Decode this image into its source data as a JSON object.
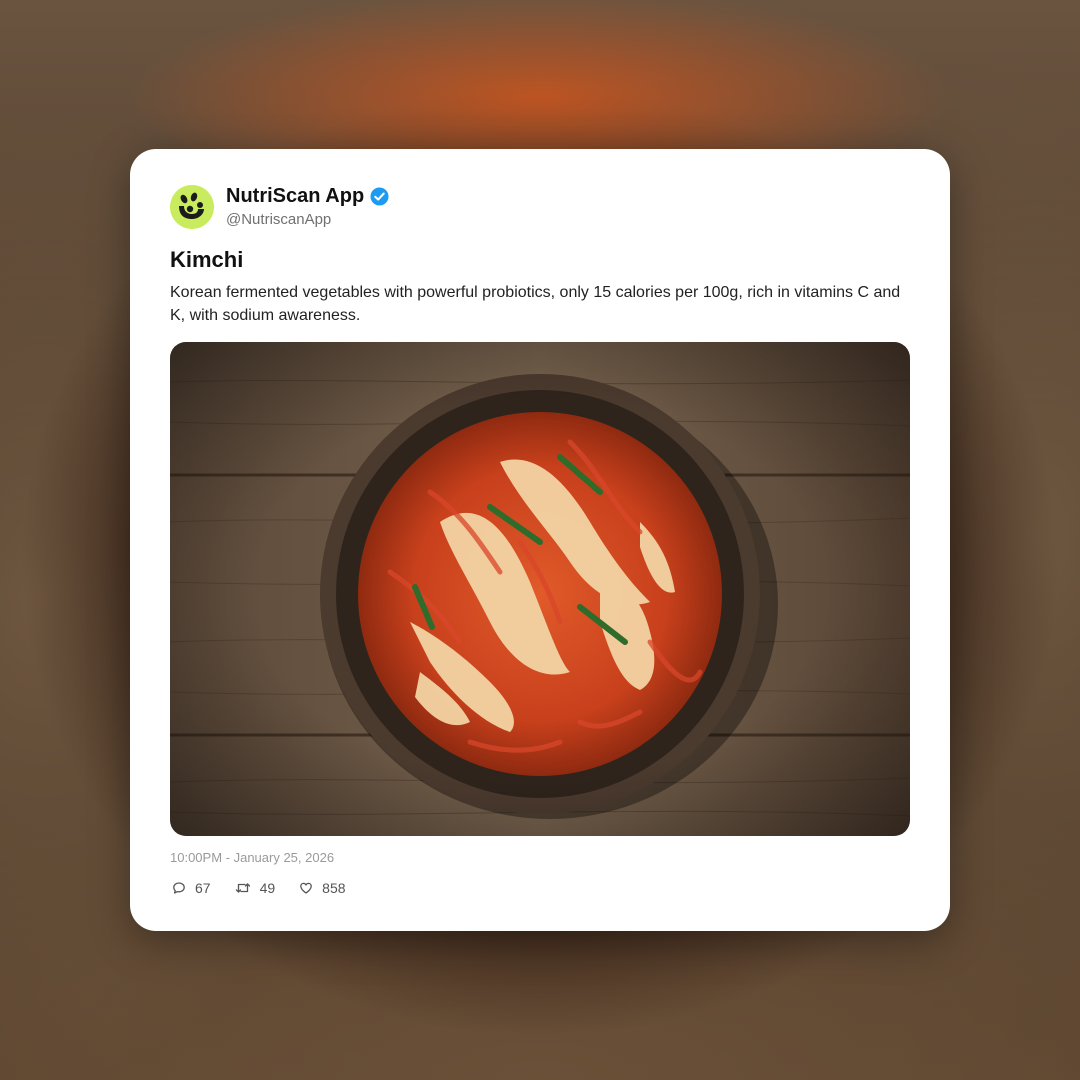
{
  "post": {
    "account_name": "NutriScan App",
    "handle": "@NutriscanApp",
    "verified": true,
    "title": "Kimchi",
    "description": "Korean fermented vegetables with powerful probiotics, only 15 calories per 100g, rich in vitamins C and K, with sodium awareness.",
    "timestamp": "10:00PM - January 25, 2026",
    "stats": {
      "replies": "67",
      "retweets": "49",
      "likes": "858"
    }
  },
  "icons": {
    "avatar": "nutriscan-logo-icon",
    "verified": "verified-badge-icon",
    "reply": "comment-icon",
    "retweet": "retweet-icon",
    "like": "heart-icon"
  },
  "colors": {
    "avatar_bg": "#c9ec5e",
    "verified_blue": "#1d9bf0",
    "card_bg": "#ffffff"
  }
}
